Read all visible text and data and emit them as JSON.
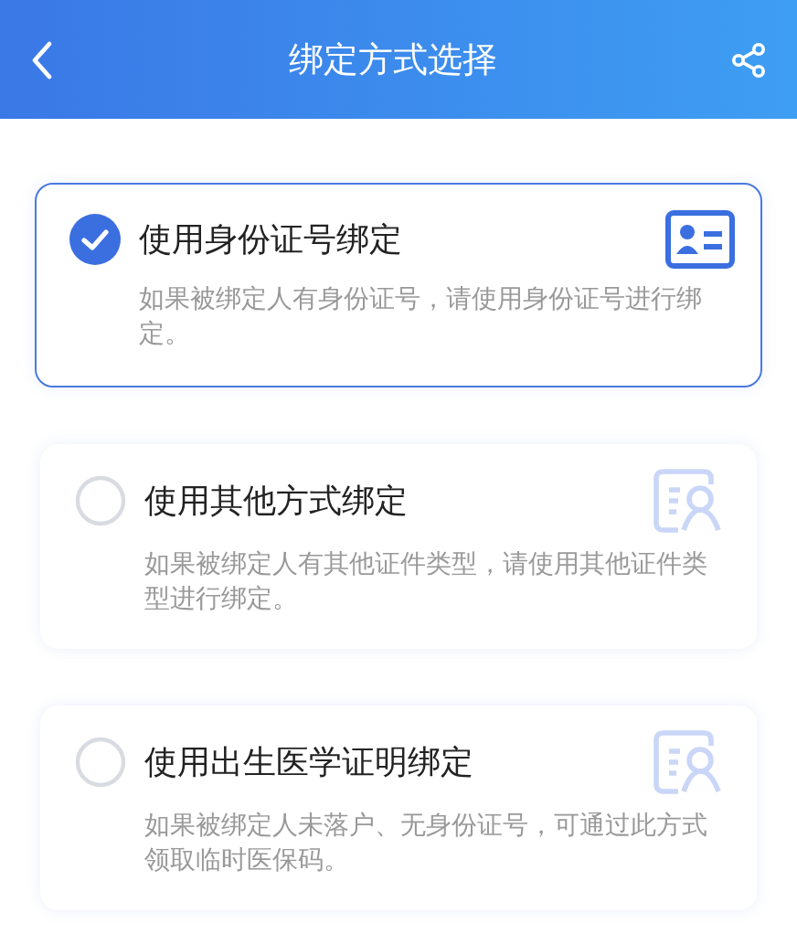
{
  "header": {
    "title": "绑定方式选择"
  },
  "options": [
    {
      "title": "使用身份证号绑定",
      "description": "如果被绑定人有身份证号，请使用身份证号进行绑定。",
      "selected": true,
      "kind": "id-card"
    },
    {
      "title": "使用其他方式绑定",
      "description": "如果被绑定人有其他证件类型，请使用其他证件类型进行绑定。",
      "selected": false,
      "kind": "document"
    },
    {
      "title": "使用出生医学证明绑定",
      "description": "如果被绑定人未落户、无身份证号，可通过此方式领取临时医保码。",
      "selected": false,
      "kind": "document"
    }
  ]
}
